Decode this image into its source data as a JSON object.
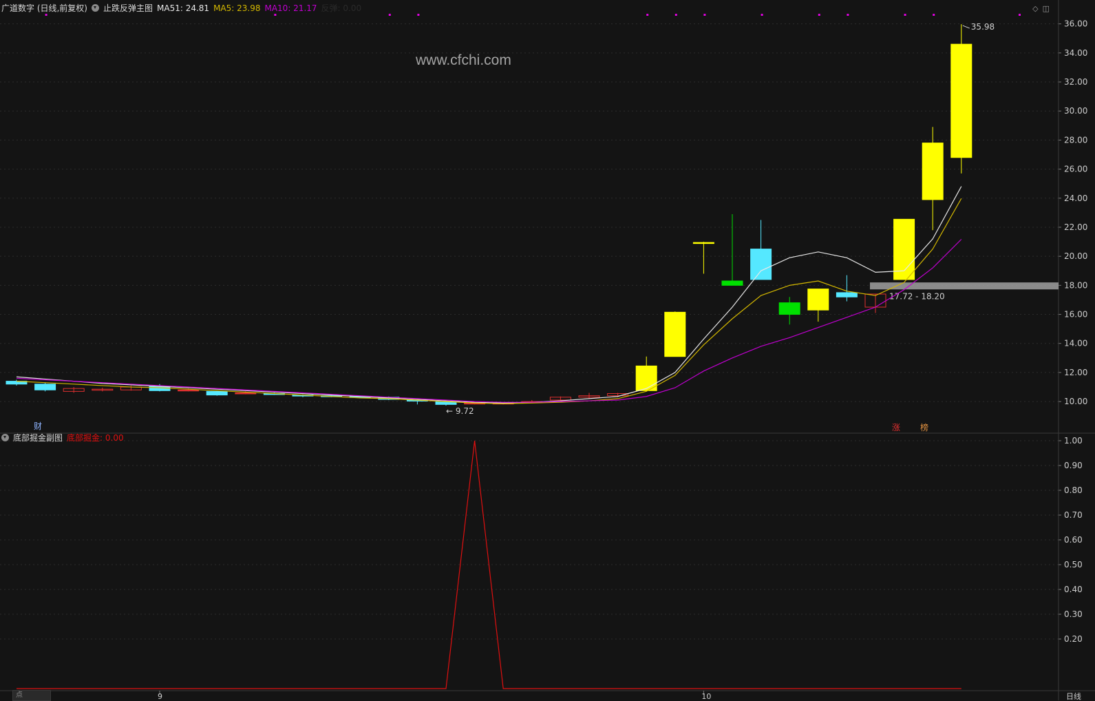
{
  "main_header": {
    "stock": "广道数字 (日线,前复权)",
    "indicator": "止跌反弹主图",
    "ma51_label": "MA51: 24.81",
    "ma5_label": "MA5: 23.98",
    "ma10_label": "MA10: 21.17",
    "fantan_label": "反弹: 0.00"
  },
  "sub_header": {
    "indicator": "底部掘金副图",
    "value_label": "底部掘金: 0.00"
  },
  "watermark": "www.cfchi.com",
  "annotations": {
    "high_label": "35.98",
    "low_label": "9.72",
    "zone_label": "17.72 - 18.20",
    "cai": "财",
    "zhang": "涨",
    "bang": "榜"
  },
  "x_ticks": [
    "9",
    "10"
  ],
  "period_label": "日线",
  "bottom_tab": "点",
  "colors": {
    "background": "#141414",
    "up": "#ffff00",
    "up_small": "#e03030",
    "down": "#55e8ff",
    "down_alt": "#00e000",
    "ma51": "#e8e8e8",
    "ma5": "#d4b800",
    "ma10": "#c000d0",
    "subline": "#e01010",
    "signal_dots": "#e000e0",
    "zone": "#a0a0a0"
  },
  "chart_data": [
    {
      "type": "candlestick",
      "title": "止跌反弹主图",
      "ylim": [
        9.2,
        36.6
      ],
      "y_ticks": [
        10,
        12,
        14,
        16,
        18,
        20,
        22,
        24,
        26,
        28,
        30,
        32,
        34,
        36
      ],
      "candles": [
        {
          "o": 11.4,
          "c": 11.2,
          "h": 11.5,
          "l": 11.1
        },
        {
          "o": 11.2,
          "c": 10.8,
          "h": 11.3,
          "l": 10.7
        },
        {
          "o": 10.7,
          "c": 10.9,
          "h": 11.0,
          "l": 10.6
        },
        {
          "o": 10.8,
          "c": 10.85,
          "h": 10.95,
          "l": 10.7
        },
        {
          "o": 10.8,
          "c": 11.0,
          "h": 11.1,
          "l": 10.75
        },
        {
          "o": 11.05,
          "c": 10.75,
          "h": 11.2,
          "l": 10.7
        },
        {
          "o": 10.8,
          "c": 10.8,
          "h": 10.9,
          "l": 10.7
        },
        {
          "o": 10.7,
          "c": 10.45,
          "h": 10.75,
          "l": 10.4
        },
        {
          "o": 10.6,
          "c": 10.6,
          "h": 10.7,
          "l": 10.5
        },
        {
          "o": 10.55,
          "c": 10.5,
          "h": 10.6,
          "l": 10.45
        },
        {
          "o": 10.45,
          "c": 10.4,
          "h": 10.5,
          "l": 10.3
        },
        {
          "o": 10.4,
          "c": 10.35,
          "h": 10.45,
          "l": 10.3
        },
        {
          "o": 10.35,
          "c": 10.3,
          "h": 10.4,
          "l": 10.25
        },
        {
          "o": 10.3,
          "c": 10.15,
          "h": 10.35,
          "l": 10.1
        },
        {
          "o": 10.1,
          "c": 10.05,
          "h": 10.2,
          "l": 9.8
        },
        {
          "o": 10.0,
          "c": 9.8,
          "h": 10.05,
          "l": 9.72
        },
        {
          "o": 9.9,
          "c": 9.9,
          "h": 9.95,
          "l": 9.8
        },
        {
          "o": 9.9,
          "c": 9.9,
          "h": 9.95,
          "l": 9.8
        },
        {
          "o": 9.95,
          "c": 10.0,
          "h": 10.1,
          "l": 9.9
        },
        {
          "o": 10.1,
          "c": 10.3,
          "h": 10.35,
          "l": 10.05
        },
        {
          "o": 10.3,
          "c": 10.4,
          "h": 10.6,
          "l": 10.2
        },
        {
          "o": 10.4,
          "c": 10.55,
          "h": 10.6,
          "l": 10.3
        },
        {
          "o": 10.75,
          "c": 12.45,
          "h": 13.1,
          "l": 10.7
        },
        {
          "o": 13.1,
          "c": 16.15,
          "h": 16.2,
          "l": 13.1
        },
        {
          "o": 20.95,
          "c": 20.95,
          "h": 21.0,
          "l": 18.8
        },
        {
          "o": 18.3,
          "c": 18.0,
          "h": 22.9,
          "l": 18.0
        },
        {
          "o": 20.5,
          "c": 18.4,
          "h": 22.5,
          "l": 18.4
        },
        {
          "o": 16.8,
          "c": 16.0,
          "h": 17.2,
          "l": 15.3
        },
        {
          "o": 16.3,
          "c": 17.75,
          "h": 17.75,
          "l": 15.5
        },
        {
          "o": 17.5,
          "c": 17.2,
          "h": 18.7,
          "l": 16.9
        },
        {
          "o": 16.5,
          "c": 17.4,
          "h": 17.4,
          "l": 16.1
        },
        {
          "o": 18.4,
          "c": 22.55,
          "h": 22.55,
          "l": 18.4
        },
        {
          "o": 23.9,
          "c": 27.8,
          "h": 28.9,
          "l": 21.8
        },
        {
          "o": 26.8,
          "c": 34.6,
          "h": 35.98,
          "l": 25.7
        }
      ],
      "series": [
        {
          "name": "MA51",
          "values": [
            11.7,
            11.55,
            11.4,
            11.25,
            11.15,
            11.05,
            10.95,
            10.85,
            10.75,
            10.65,
            10.55,
            10.45,
            10.35,
            10.25,
            10.15,
            10.05,
            9.95,
            9.9,
            9.95,
            10.05,
            10.2,
            10.35,
            10.9,
            12.0,
            14.3,
            16.5,
            19.0,
            19.9,
            20.3,
            19.9,
            18.9,
            19.0,
            21.2,
            24.81
          ]
        },
        {
          "name": "MA5",
          "values": [
            11.4,
            11.3,
            11.2,
            11.1,
            11.0,
            10.95,
            10.85,
            10.75,
            10.65,
            10.55,
            10.45,
            10.35,
            10.25,
            10.2,
            10.1,
            10.0,
            9.9,
            9.85,
            9.9,
            9.95,
            10.05,
            10.2,
            10.7,
            11.8,
            13.9,
            15.7,
            17.3,
            18.0,
            18.3,
            17.6,
            17.3,
            18.2,
            20.5,
            23.98
          ]
        },
        {
          "name": "MA10",
          "values": [
            11.6,
            11.5,
            11.4,
            11.3,
            11.2,
            11.1,
            11.0,
            10.9,
            10.8,
            10.7,
            10.6,
            10.5,
            10.4,
            10.3,
            10.2,
            10.1,
            10.0,
            9.95,
            9.95,
            10.0,
            10.05,
            10.1,
            10.35,
            10.95,
            12.1,
            13.0,
            13.8,
            14.4,
            15.1,
            15.8,
            16.5,
            17.7,
            19.2,
            21.17
          ]
        }
      ],
      "signal_dots": [
        1,
        9,
        13,
        14,
        22,
        23,
        24,
        26,
        28,
        29,
        31,
        32,
        35
      ],
      "zone": [
        17.72,
        18.2
      ]
    },
    {
      "type": "line",
      "title": "底部掘金副图",
      "ylim": [
        0,
        1.0
      ],
      "y_ticks": [
        0.2,
        0.3,
        0.4,
        0.5,
        0.6,
        0.7,
        0.8,
        0.9,
        1.0
      ],
      "series": [
        {
          "name": "底部掘金",
          "values": [
            0,
            0,
            0,
            0,
            0,
            0,
            0,
            0,
            0,
            0,
            0,
            0,
            0,
            0,
            0,
            0,
            1,
            0,
            0,
            0,
            0,
            0,
            0,
            0,
            0,
            0,
            0,
            0,
            0,
            0,
            0,
            0,
            0,
            0
          ]
        }
      ]
    }
  ]
}
